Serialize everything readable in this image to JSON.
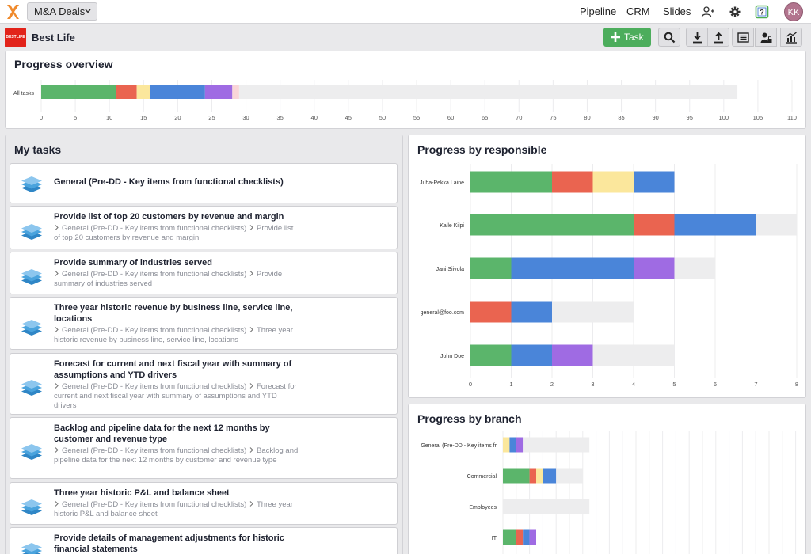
{
  "topbar": {
    "deal_select": "M&A Deals",
    "nav": [
      "Pipeline",
      "CRM",
      "Slides"
    ],
    "icons": [
      "users-icon",
      "gear-icon",
      "help-icon"
    ],
    "avatar_initials": "KK"
  },
  "subbar": {
    "brand_logo_text": "BESTLIFE",
    "company": "Best Life",
    "task_button": "Task",
    "tools": [
      "search-icon",
      "download-icon",
      "upload-icon",
      "list-icon",
      "user-lock-icon",
      "chart-icon"
    ]
  },
  "progress_overview": {
    "title": "Progress overview"
  },
  "my_tasks": {
    "title": "My tasks",
    "items": [
      {
        "title": "General (Pre-DD - Key items from functional checklists)",
        "path": ""
      },
      {
        "title": "Provide list of top 20 customers by revenue and margin",
        "path_parent": "General (Pre-DD - Key items from functional checklists)",
        "path_self": "Provide list of top 20 customers by revenue and margin"
      },
      {
        "title": "Provide summary of industries served",
        "path_parent": "General (Pre-DD - Key items from functional checklists)",
        "path_self": "Provide summary of industries served"
      },
      {
        "title": "Three year historic revenue by business line, service line, locations",
        "path_parent": "General (Pre-DD - Key items from functional checklists)",
        "path_self": "Three year historic revenue by business line, service line, locations"
      },
      {
        "title": "Forecast for current and next fiscal year with summary of assumptions and YTD drivers",
        "path_parent": "General (Pre-DD - Key items from functional checklists)",
        "path_self": "Forecast for current and next fiscal year with summary of assumptions and YTD drivers"
      },
      {
        "title": "Backlog and pipeline data for the next 12 months by customer and revenue type",
        "path_parent": "General (Pre-DD - Key items from functional checklists)",
        "path_self": "Backlog and pipeline data for the next 12 months by customer and revenue type"
      },
      {
        "title": "Three year historic P&L and balance sheet",
        "path_parent": "General (Pre-DD - Key items from functional checklists)",
        "path_self": "Three year historic P&L and balance sheet"
      },
      {
        "title": "Provide details of management adjustments for historic financial statements",
        "path_parent": "",
        "path_self": ""
      }
    ]
  },
  "responsible": {
    "title": "Progress by responsible"
  },
  "branch": {
    "title": "Progress by branch"
  },
  "colors": {
    "done": "#5bb56b",
    "late": "#ea6450",
    "waiting": "#fbe79c",
    "in_progress": "#4a85d9",
    "review": "#9f6be3",
    "other": "#f9d5d8",
    "open": "#ededee"
  },
  "chart_data": [
    {
      "type": "bar",
      "orientation": "horizontal",
      "stacked": true,
      "categories": [
        "All tasks"
      ],
      "segments": [
        11,
        3,
        2,
        8,
        4,
        1,
        73
      ],
      "segment_keys": [
        "done",
        "late",
        "waiting",
        "in_progress",
        "review",
        "other",
        "open"
      ],
      "xlim": [
        0,
        110
      ],
      "xticks": [
        0,
        5,
        10,
        15,
        20,
        25,
        30,
        35,
        40,
        45,
        50,
        55,
        60,
        65,
        70,
        75,
        80,
        85,
        90,
        95,
        100,
        105,
        110
      ],
      "grid": true
    },
    {
      "type": "bar",
      "orientation": "horizontal",
      "stacked": true,
      "categories": [
        "Juha-Pekka Laine",
        "Kalle Kilpi",
        "Jani Siivola",
        "general@foo.com",
        "John Doe"
      ],
      "series": [
        {
          "key": "done",
          "values": [
            2,
            4,
            1,
            0,
            1
          ]
        },
        {
          "key": "late",
          "values": [
            1,
            1,
            0,
            1,
            0
          ]
        },
        {
          "key": "waiting",
          "values": [
            1,
            0,
            0,
            0,
            0
          ]
        },
        {
          "key": "in_progress",
          "values": [
            1,
            2,
            3,
            1,
            1
          ]
        },
        {
          "key": "review",
          "values": [
            0,
            0,
            1,
            0,
            1
          ]
        },
        {
          "key": "open",
          "values": [
            0,
            1,
            1,
            2,
            2
          ]
        }
      ],
      "xlim": [
        0,
        8
      ],
      "xticks": [
        0,
        1,
        2,
        3,
        4,
        5,
        6,
        7,
        8
      ],
      "grid": true
    },
    {
      "type": "bar",
      "orientation": "horizontal",
      "stacked": true,
      "categories": [
        "General (Pre-DD - Key items fr",
        "Commercial",
        "Employees",
        "IT"
      ],
      "series": [
        {
          "key": "done",
          "values": [
            0,
            4,
            0,
            2
          ]
        },
        {
          "key": "late",
          "values": [
            0,
            1,
            0,
            1
          ]
        },
        {
          "key": "waiting",
          "values": [
            1,
            1,
            0,
            0
          ]
        },
        {
          "key": "in_progress",
          "values": [
            1,
            2,
            0,
            1
          ]
        },
        {
          "key": "review",
          "values": [
            1,
            0,
            0,
            1
          ]
        },
        {
          "key": "open",
          "values": [
            10,
            4,
            13,
            0
          ]
        }
      ],
      "grid": true
    }
  ]
}
